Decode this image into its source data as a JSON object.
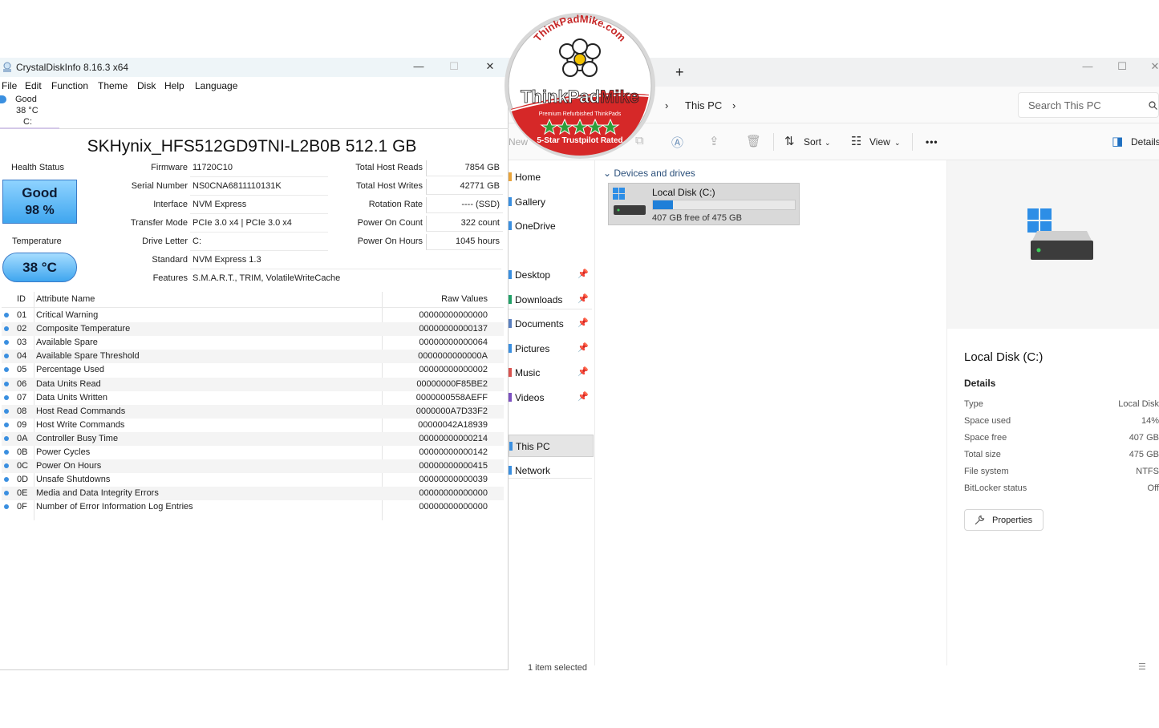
{
  "cdi": {
    "window_title": "CrystalDiskInfo 8.16.3 x64",
    "menu": [
      "File",
      "Edit",
      "Function",
      "Theme",
      "Disk",
      "Help",
      "Language"
    ],
    "disk_tab": {
      "status": "Good",
      "temp": "38 °C",
      "letter": "C:"
    },
    "model": "SKHynix_HFS512GD9TNI-L2B0B 512.1 GB",
    "health_label": "Health Status",
    "health_status": "Good",
    "health_percent": "98 %",
    "temperature_label": "Temperature",
    "temperature": "38 °C",
    "fields": {
      "firmware_label": "Firmware",
      "firmware": "11720C10",
      "serial_label": "Serial Number",
      "serial": "NS0CNA6811110131K",
      "interface_label": "Interface",
      "interface": "NVM Express",
      "transfer_label": "Transfer Mode",
      "transfer": "PCIe 3.0 x4 | PCIe 3.0 x4",
      "drive_letter_label": "Drive Letter",
      "drive_letter": "C:",
      "standard_label": "Standard",
      "standard": "NVM Express 1.3",
      "features_label": "Features",
      "features": "S.M.A.R.T., TRIM, VolatileWriteCache",
      "reads_label": "Total Host Reads",
      "reads": "7854 GB",
      "writes_label": "Total Host Writes",
      "writes": "42771 GB",
      "rotation_label": "Rotation Rate",
      "rotation": "---- (SSD)",
      "power_count_label": "Power On Count",
      "power_count": "322 count",
      "power_hours_label": "Power On Hours",
      "power_hours": "1045 hours"
    },
    "attr_headers": {
      "id": "ID",
      "name": "Attribute Name",
      "raw": "Raw Values"
    },
    "attributes": [
      {
        "id": "01",
        "name": "Critical Warning",
        "raw": "00000000000000"
      },
      {
        "id": "02",
        "name": "Composite Temperature",
        "raw": "00000000000137"
      },
      {
        "id": "03",
        "name": "Available Spare",
        "raw": "00000000000064"
      },
      {
        "id": "04",
        "name": "Available Spare Threshold",
        "raw": "0000000000000A"
      },
      {
        "id": "05",
        "name": "Percentage Used",
        "raw": "00000000000002"
      },
      {
        "id": "06",
        "name": "Data Units Read",
        "raw": "00000000F85BE2"
      },
      {
        "id": "07",
        "name": "Data Units Written",
        "raw": "0000000558AEFF"
      },
      {
        "id": "08",
        "name": "Host Read Commands",
        "raw": "0000000A7D33F2"
      },
      {
        "id": "09",
        "name": "Host Write Commands",
        "raw": "00000042A18939"
      },
      {
        "id": "0A",
        "name": "Controller Busy Time",
        "raw": "00000000000214"
      },
      {
        "id": "0B",
        "name": "Power Cycles",
        "raw": "00000000000142"
      },
      {
        "id": "0C",
        "name": "Power On Hours",
        "raw": "00000000000415"
      },
      {
        "id": "0D",
        "name": "Unsafe Shutdowns",
        "raw": "00000000000039"
      },
      {
        "id": "0E",
        "name": "Media and Data Integrity Errors",
        "raw": "00000000000000"
      },
      {
        "id": "0F",
        "name": "Number of Error Information Log Entries",
        "raw": "00000000000000"
      }
    ]
  },
  "explorer": {
    "breadcrumb": "This PC",
    "search_placeholder": "Search This PC",
    "toolbar": {
      "new": "New",
      "sort": "Sort",
      "view": "View",
      "more": "•••",
      "details": "Details"
    },
    "nav": [
      {
        "label": "Home",
        "color": "#e8a33a"
      },
      {
        "label": "Gallery",
        "color": "#3a8fe0"
      },
      {
        "label": "OneDrive",
        "color": "#3a8fe0"
      },
      {
        "label": "Desktop",
        "color": "#3a8fe0",
        "pinned": true
      },
      {
        "label": "Downloads",
        "color": "#21a067",
        "pinned": true
      },
      {
        "label": "Documents",
        "color": "#5a7fbf",
        "pinned": true
      },
      {
        "label": "Pictures",
        "color": "#3a8fe0",
        "pinned": true
      },
      {
        "label": "Music",
        "color": "#d9534f",
        "pinned": true
      },
      {
        "label": "Videos",
        "color": "#7b4fbf",
        "pinned": true
      },
      {
        "label": "This PC",
        "color": "#3a8fe0",
        "selected": true
      },
      {
        "label": "Network",
        "color": "#3a8fe0"
      }
    ],
    "group_label": "Devices and drives",
    "drive": {
      "name": "Local Disk (C:)",
      "free_text": "407 GB free of 475 GB",
      "used_fraction": 0.14
    },
    "details_title": "Local Disk (C:)",
    "details_heading": "Details",
    "details": [
      {
        "k": "Type",
        "v": "Local Disk"
      },
      {
        "k": "Space used",
        "v": "14%"
      },
      {
        "k": "Space free",
        "v": "407 GB"
      },
      {
        "k": "Total size",
        "v": "475 GB"
      },
      {
        "k": "File system",
        "v": "NTFS"
      },
      {
        "k": "BitLocker status",
        "v": "Off"
      }
    ],
    "properties_label": "Properties",
    "status": "1 item selected"
  },
  "badge": {
    "site": "ThinkPadMike.com",
    "name_a": "ThinkPad",
    "name_b": "Mike",
    "tagline": "Premium Refurbished ThinkPads",
    "rating": "5-Star Trustpilot Rated"
  }
}
